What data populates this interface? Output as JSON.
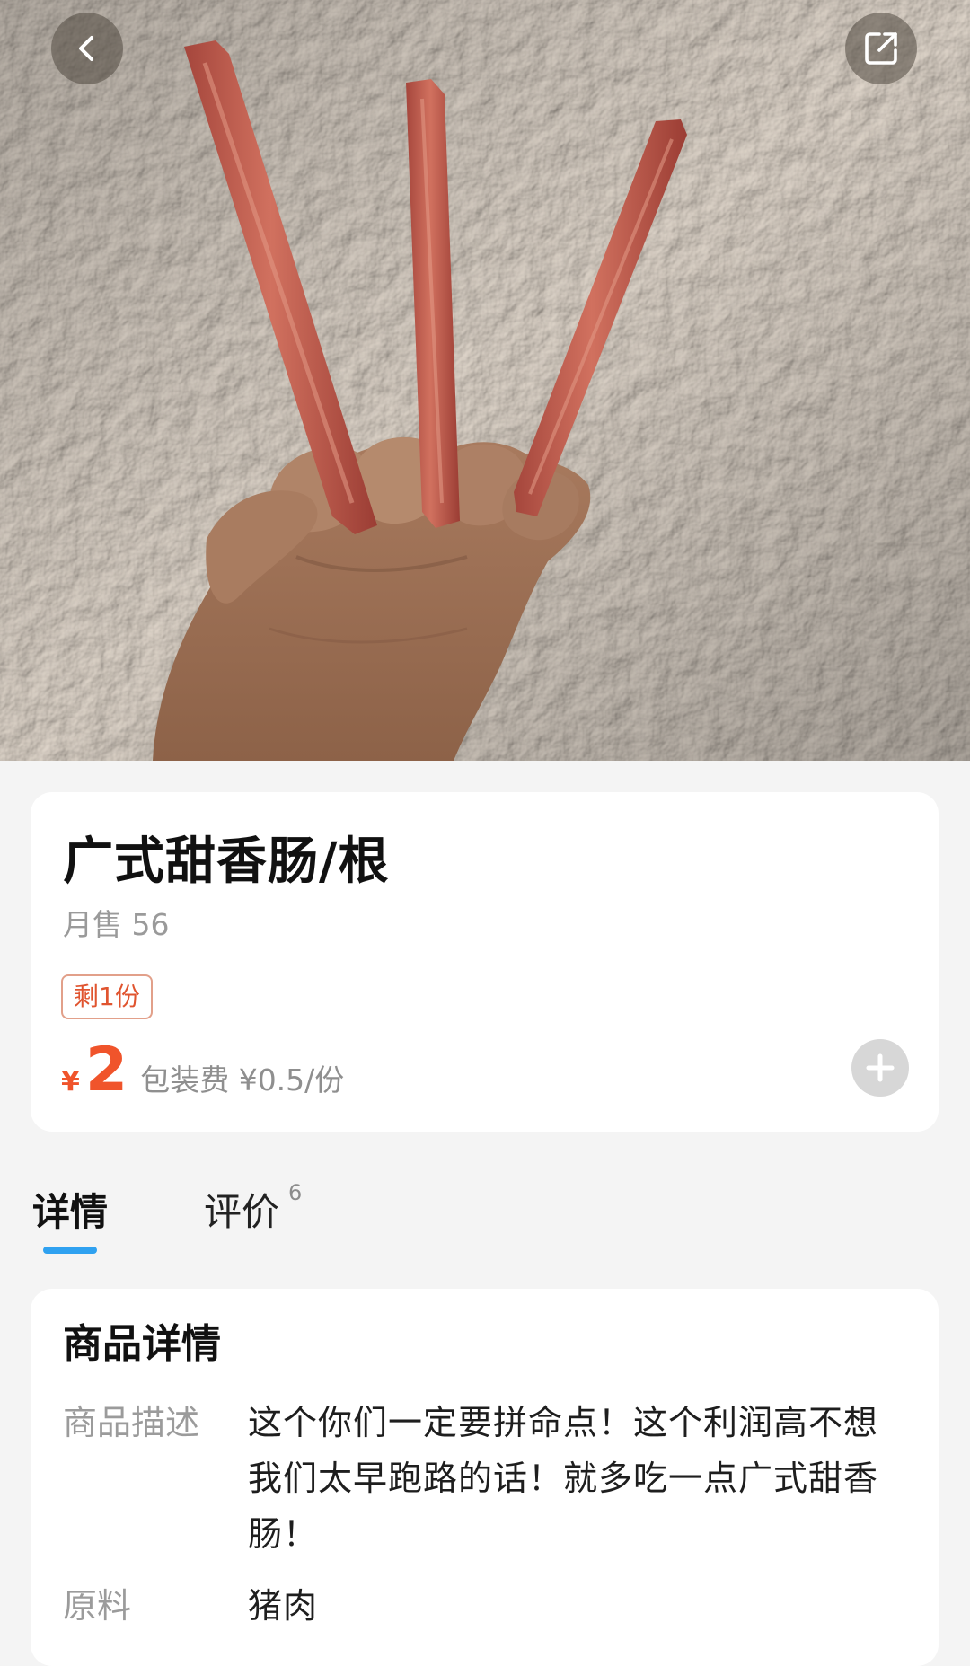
{
  "nav": {
    "back_icon": "chevron-left-icon",
    "share_icon": "share-external-icon"
  },
  "product": {
    "name": "广式甜香肠/根",
    "monthly_sales": "月售 56",
    "stock_badge": "剩1份",
    "price_symbol": "¥",
    "price": "2",
    "packing_fee": "包装费 ¥0.5/份",
    "add_icon": "plus-icon"
  },
  "tabs": [
    {
      "label": "详情",
      "active": true
    },
    {
      "label": "评价",
      "count": "6",
      "active": false
    }
  ],
  "details": {
    "title": "商品详情",
    "rows": [
      {
        "key": "商品描述",
        "value": "这个你们一定要拼命点！这个利润高不想我们太早跑路的话！就多吃一点广式甜香肠！"
      },
      {
        "key": "原料",
        "value": "猪肉"
      }
    ]
  },
  "colors": {
    "accent_price": "#f0542b",
    "tab_indicator": "#2fa1f0",
    "page_background": "#f4f4f4"
  }
}
